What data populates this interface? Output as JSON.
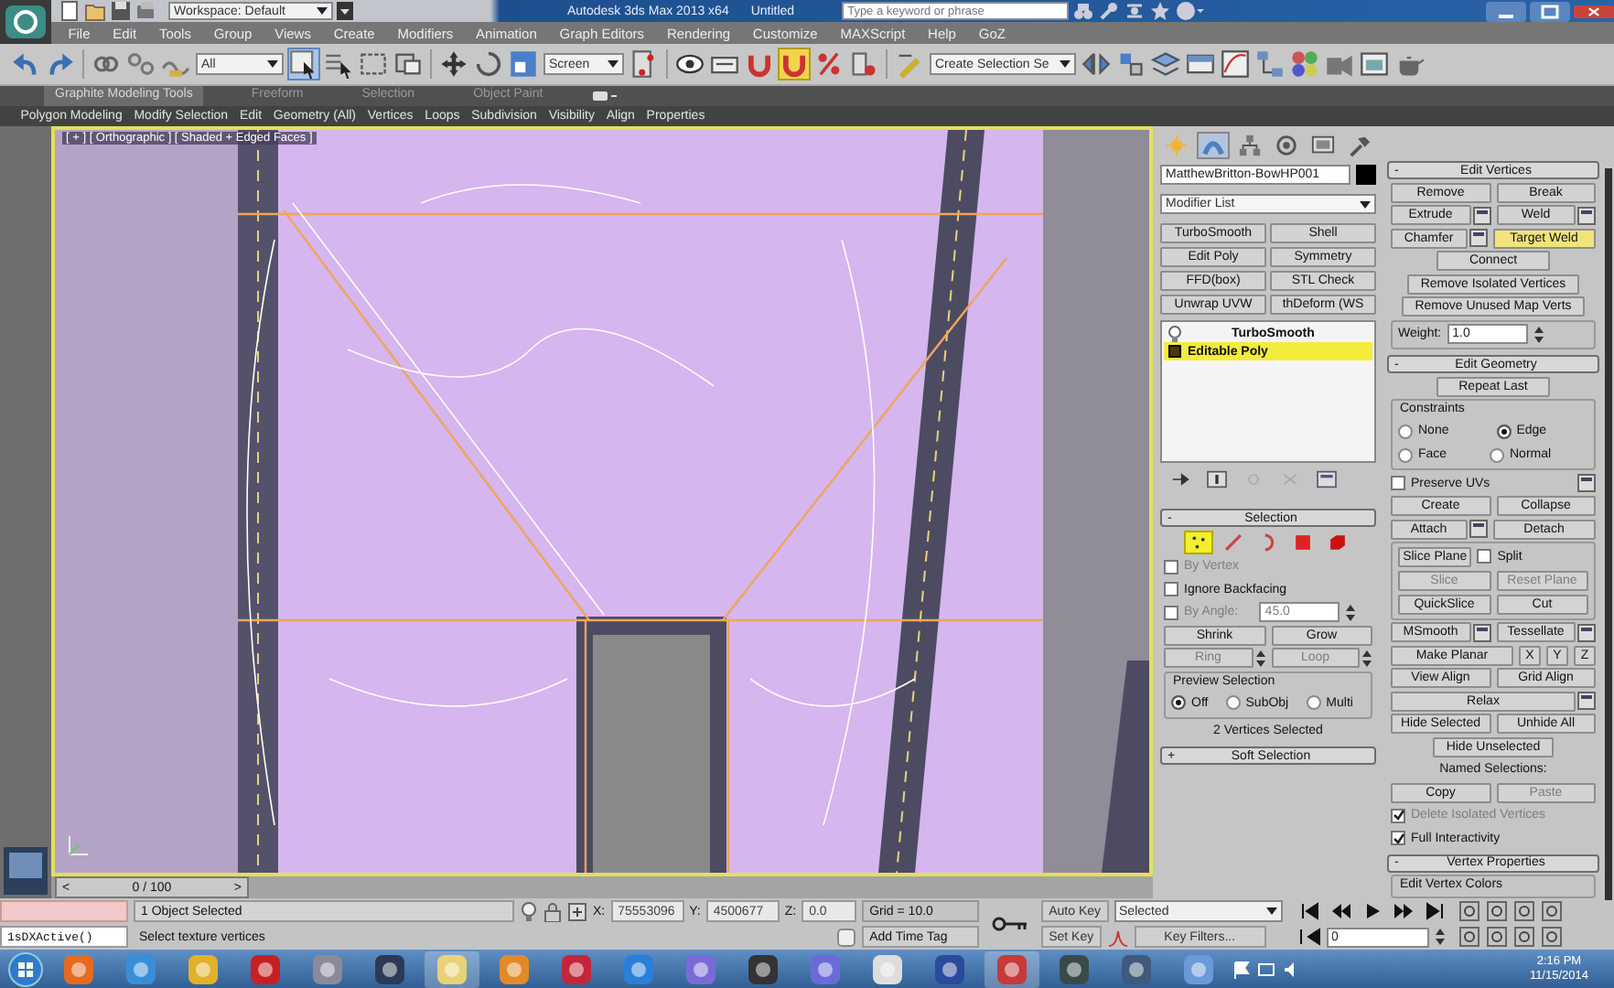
{
  "title_bar": {
    "workspace": "Workspace: Default",
    "app_title": "Autodesk 3ds Max 2013 x64",
    "document": "Untitled",
    "search": {
      "placeholder": "Type a keyword or phrase"
    }
  },
  "menu_bar": [
    "File",
    "Edit",
    "Tools",
    "Group",
    "Views",
    "Create",
    "Modifiers",
    "Animation",
    "Graph Editors",
    "Rendering",
    "Customize",
    "MAXScript",
    "Help",
    "GoZ"
  ],
  "main_toolbar": {
    "selection_filter": "All",
    "reference_coordinate_system": "Screen",
    "named_selection_set": "Create Selection Se",
    "snap_toggle": {
      "on": true
    }
  },
  "ribbon": {
    "tabs": [
      {
        "label": "Graphite Modeling Tools",
        "selected": true
      },
      {
        "label": "Freeform",
        "selected": false
      },
      {
        "label": "Selection",
        "selected": false
      },
      {
        "label": "Object Paint",
        "selected": false
      }
    ],
    "panels": [
      "Polygon Modeling",
      "Modify Selection",
      "Edit",
      "Geometry (All)",
      "Vertices",
      "Loops",
      "Subdivision",
      "Visibility",
      "Align",
      "Properties"
    ]
  },
  "viewport": {
    "label": "[ + ] [ Orthographic ] [ Shaded + Edged Faces ]"
  },
  "time_slider": {
    "prev": "<",
    "position": "0 / 100",
    "next": ">"
  },
  "command_panel": {
    "tabs": [
      {
        "selected": false
      },
      {
        "selected": true
      },
      {
        "selected": false
      },
      {
        "selected": false
      },
      {
        "selected": false
      },
      {
        "selected": false
      }
    ],
    "object_name": "MatthewBritton-BowHP001",
    "modifier_list": "Modifier List",
    "modifier_buttons": [
      "TurboSmooth",
      "Shell",
      "Edit Poly",
      "Symmetry",
      "FFD(box)",
      "STL Check",
      "Unwrap UVW",
      "thDeform (WS"
    ],
    "stack": [
      {
        "label": "TurboSmooth",
        "kind": "modifier",
        "selected": false
      },
      {
        "label": "Editable Poly",
        "kind": "base-object",
        "selected": true
      }
    ],
    "left_rollouts": [
      {
        "toggle": "-",
        "title": "Selection",
        "rows": [
          [
            {
              "kind": "subobject",
              "items": [
                {
                  "selected": true
                },
                {
                  "selected": false
                },
                {
                  "selected": false
                },
                {
                  "selected": false
                },
                {
                  "selected": false
                }
              ]
            }
          ],
          [
            {
              "kind": "checkbox",
              "label": "By Vertex",
              "checked": false,
              "disabled": true
            }
          ],
          [
            {
              "kind": "checkbox",
              "label": "Ignore Backfacing",
              "checked": false,
              "disabled": false
            }
          ],
          [
            {
              "kind": "checkbox",
              "label": "By Angle:",
              "checked": false,
              "disabled": true
            },
            {
              "kind": "spinner",
              "value": "45.0",
              "disabled": true
            }
          ],
          [
            {
              "kind": "button",
              "label": "Shrink",
              "disabled": false
            },
            {
              "kind": "button",
              "label": "Grow",
              "disabled": false
            }
          ],
          [
            {
              "kind": "spin-button",
              "label": "Ring",
              "disabled": true
            },
            {
              "kind": "spin-button",
              "label": "Loop",
              "disabled": true
            }
          ],
          [
            {
              "kind": "group",
              "title": "Preview Selection",
              "rows": [
                [
                  {
                    "kind": "radio",
                    "label": "Off",
                    "selected": true
                  },
                  {
                    "kind": "radio",
                    "label": "SubObj",
                    "selected": false
                  },
                  {
                    "kind": "radio",
                    "label": "Multi",
                    "selected": false
                  }
                ]
              ]
            }
          ],
          [
            {
              "kind": "text",
              "label": "2 Vertices Selected"
            }
          ]
        ]
      },
      {
        "toggle": "+",
        "title": "Soft Selection"
      }
    ],
    "right_rollouts": [
      {
        "toggle": "-",
        "title": "Edit Vertices",
        "rows": [
          [
            {
              "kind": "button",
              "label": "Remove",
              "disabled": false
            },
            {
              "kind": "button",
              "label": "Break",
              "disabled": false
            }
          ],
          [
            {
              "kind": "settings-button",
              "label": "Extrude",
              "disabled": false
            },
            {
              "kind": "settings-button",
              "label": "Weld",
              "disabled": false
            }
          ],
          [
            {
              "kind": "settings-button",
              "label": "Chamfer",
              "disabled": false
            },
            {
              "kind": "toggle-button",
              "label": "Target Weld",
              "on": true
            }
          ],
          [
            {
              "kind": "button",
              "label": "Connect",
              "disabled": false
            }
          ],
          [
            {
              "kind": "button",
              "label": "Remove Isolated Vertices",
              "disabled": false
            }
          ],
          [
            {
              "kind": "button",
              "label": "Remove Unused Map Verts",
              "disabled": false
            }
          ],
          [
            {
              "kind": "group",
              "rows": [
                [
                  {
                    "kind": "spinner",
                    "label": "Weight:",
                    "value": "1.0",
                    "disabled": false
                  }
                ]
              ]
            }
          ]
        ]
      },
      {
        "toggle": "-",
        "title": "Edit Geometry",
        "rows": [
          [
            {
              "kind": "button",
              "label": "Repeat Last",
              "disabled": false
            }
          ],
          [
            {
              "kind": "group",
              "title": "Constraints",
              "rows": [
                [
                  {
                    "kind": "radio",
                    "label": "None",
                    "selected": false
                  },
                  {
                    "kind": "radio",
                    "label": "Edge",
                    "selected": true
                  }
                ],
                [
                  {
                    "kind": "radio",
                    "label": "Face",
                    "selected": false
                  },
                  {
                    "kind": "radio",
                    "label": "Normal",
                    "selected": false
                  }
                ]
              ]
            }
          ],
          [
            {
              "kind": "checkbox",
              "label": "Preserve UVs",
              "checked": false,
              "disabled": false
            },
            {
              "kind": "settings"
            }
          ],
          [
            {
              "kind": "button",
              "label": "Create",
              "disabled": false
            },
            {
              "kind": "button",
              "label": "Collapse",
              "disabled": false
            }
          ],
          [
            {
              "kind": "settings-button",
              "label": "Attach",
              "disabled": false
            },
            {
              "kind": "button",
              "label": "Detach",
              "disabled": false
            }
          ],
          [
            {
              "kind": "group",
              "rows": [
                [
                  {
                    "kind": "button",
                    "label": "Slice Plane",
                    "disabled": false
                  },
                  {
                    "kind": "checkbox",
                    "label": "Split",
                    "checked": false,
                    "disabled": false
                  }
                ],
                [
                  {
                    "kind": "button",
                    "label": "Slice",
                    "disabled": true
                  },
                  {
                    "kind": "button",
                    "label": "Reset Plane",
                    "disabled": true
                  }
                ],
                [
                  {
                    "kind": "button",
                    "label": "QuickSlice",
                    "disabled": false
                  },
                  {
                    "kind": "button",
                    "label": "Cut",
                    "disabled": false
                  }
                ]
              ]
            }
          ],
          [
            {
              "kind": "settings-button",
              "label": "MSmooth",
              "disabled": false
            },
            {
              "kind": "settings-button",
              "label": "Tessellate",
              "disabled": false
            }
          ],
          [
            {
              "kind": "button",
              "label": "Make Planar",
              "disabled": false
            },
            {
              "kind": "axis-button",
              "label": "X",
              "disabled": false
            },
            {
              "kind": "axis-button",
              "label": "Y",
              "disabled": false
            },
            {
              "kind": "axis-button",
              "label": "Z",
              "disabled": false
            }
          ],
          [
            {
              "kind": "button",
              "label": "View Align",
              "disabled": false
            },
            {
              "kind": "button",
              "label": "Grid Align",
              "disabled": false
            }
          ],
          [
            {
              "kind": "settings-button",
              "label": "Relax",
              "disabled": false
            }
          ],
          [
            {
              "kind": "button",
              "label": "Hide Selected",
              "disabled": false
            },
            {
              "kind": "button",
              "label": "Unhide All",
              "disabled": false
            }
          ],
          [
            {
              "kind": "button",
              "label": "Hide Unselected",
              "disabled": false
            }
          ],
          [
            {
              "kind": "text",
              "label": "Named Selections:"
            }
          ],
          [
            {
              "kind": "button",
              "label": "Copy",
              "disabled": false
            },
            {
              "kind": "button",
              "label": "Paste",
              "disabled": true
            }
          ],
          [
            {
              "kind": "checkbox",
              "label": "Delete Isolated Vertices",
              "checked": true,
              "disabled": true
            }
          ],
          [
            {
              "kind": "checkbox",
              "label": "Full Interactivity",
              "checked": true,
              "disabled": false
            }
          ]
        ]
      },
      {
        "toggle": "-",
        "title": "Vertex Properties",
        "rows": [
          [
            {
              "kind": "group",
              "title": "Edit Vertex Colors"
            }
          ]
        ]
      }
    ]
  },
  "status_bar": {
    "listener_output": "1sDXActive()",
    "prompt": "1 Object Selected",
    "hint": "Select texture vertices",
    "x": {
      "label": "X:",
      "value": "75553096"
    },
    "y": {
      "label": "Y:",
      "value": "4500677"
    },
    "z": {
      "label": "Z:",
      "value": "0.0"
    },
    "grid": "Grid = 10.0",
    "add_time_tag": "Add Time Tag",
    "auto_key": "Auto Key",
    "set_key": "Set Key",
    "key_filter_set": "Selected",
    "key_filters": "Key Filters...",
    "current_frame": "0"
  },
  "taskbar": {
    "time": "2:16 PM",
    "date": "11/15/2014"
  }
}
